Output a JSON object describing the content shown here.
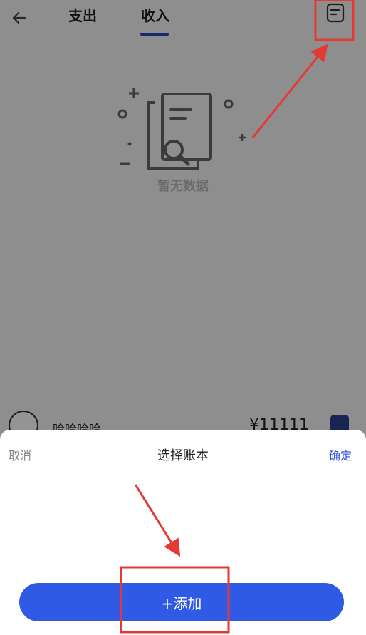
{
  "header": {
    "tabs": [
      {
        "label": "支出",
        "active": false
      },
      {
        "label": "收入",
        "active": true
      }
    ],
    "back_icon": "arrow-left-icon",
    "ledger_icon": "note-icon"
  },
  "empty_state": {
    "text": "暂无数据",
    "icon": "document-search-icon"
  },
  "list_row": {
    "name": "哈哈哈哈",
    "amount": "¥11111"
  },
  "sheet": {
    "cancel_label": "取消",
    "title": "选择账本",
    "confirm_label": "确定",
    "add_label": "+添加"
  },
  "colors": {
    "accent": "#2f5ae6",
    "tab_indicator": "#2a48b5",
    "annotation": "#e53935"
  }
}
